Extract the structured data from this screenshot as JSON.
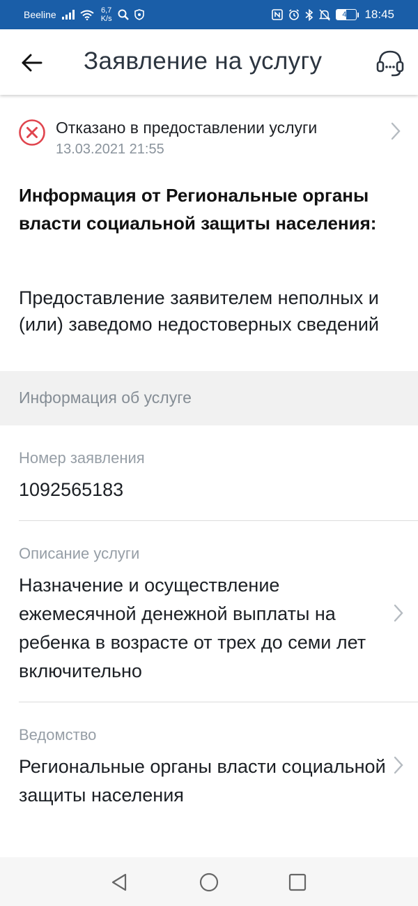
{
  "status_bar": {
    "carrier": "Beeline",
    "net_speed_value": "6,7",
    "net_speed_unit": "K/s",
    "battery_level": 49,
    "battery_text": "49",
    "time": "18:45"
  },
  "header": {
    "title": "Заявление на услугу",
    "back_icon": "arrow-left-icon",
    "support_icon": "headset-icon"
  },
  "status": {
    "text": "Отказано в предоставлении услуги",
    "date": "13.03.2021 21:55",
    "icon": "x-circle-icon",
    "color": "#e0444d"
  },
  "info": {
    "title": "Информация от Региональные органы власти социальной защиты населения:",
    "body": "Предоставление заявителем неполных и (или) заведомо недостоверных сведений"
  },
  "section": {
    "title": "Информация об услуге"
  },
  "fields": [
    {
      "label": "Номер заявления",
      "value": "1092565183"
    },
    {
      "label": "Описание услуги",
      "value": "Назначение и осуществление ежемесячной денежной выплаты на ребенка в возрасте от трех до семи лет включительно"
    },
    {
      "label": "Ведомство",
      "value": "Региональные органы власти социальной защиты населения"
    }
  ],
  "colors": {
    "status_bar": "#1a5ea8",
    "title_text": "#2c3540",
    "error": "#e0444d",
    "muted": "#969ea6"
  }
}
